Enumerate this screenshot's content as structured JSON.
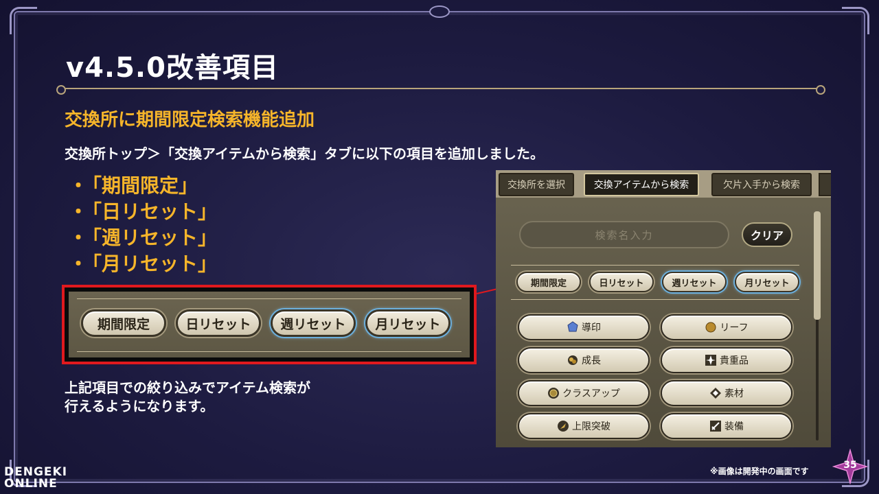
{
  "slide": {
    "title": "v4.5.0改善項目",
    "subtitle": "交換所に期間限定検索機能追加",
    "description": "交換所トップ＞「交換アイテムから検索」タブに以下の項目を追加しました。",
    "bullets": [
      "「期間限定」",
      "「日リセット」",
      "「週リセット」",
      "「月リセット」"
    ],
    "bullet_marker": "・",
    "bottom_line1": "上記項目での絞り込みでアイテム検索が",
    "bottom_line2": "行えるようになります。",
    "note": "※画像は開発中の画面です",
    "page_number": "35"
  },
  "zoom_filters": [
    "期間限定",
    "日リセット",
    "週リセット",
    "月リセット"
  ],
  "game": {
    "tabs": [
      "交換所を選択",
      "交換アイテムから検索",
      "欠片入手から検索"
    ],
    "active_tab": "交換アイテムから検索",
    "search_placeholder": "検索名入力",
    "clear_label": "クリア",
    "filters": [
      "期間限定",
      "日リセット",
      "週リセット",
      "月リセット"
    ],
    "categories": [
      {
        "label": "導印",
        "icon": "crystal-icon"
      },
      {
        "label": "リーフ",
        "icon": "leaf-coin-icon"
      },
      {
        "label": "成長",
        "icon": "growth-icon"
      },
      {
        "label": "貴重品",
        "icon": "sparkle-icon"
      },
      {
        "label": "クラスアップ",
        "icon": "class-up-icon"
      },
      {
        "label": "素材",
        "icon": "material-icon"
      },
      {
        "label": "上限突破",
        "icon": "limit-break-icon"
      },
      {
        "label": "装備",
        "icon": "sword-icon"
      }
    ]
  },
  "logo": {
    "main1": "DENGEKI",
    "main2": "ONLINE",
    "sub": "電撃オンライン"
  },
  "colors": {
    "accent": "#f6b52a",
    "highlight_border": "#e0191e",
    "background": "#1d1b40"
  }
}
